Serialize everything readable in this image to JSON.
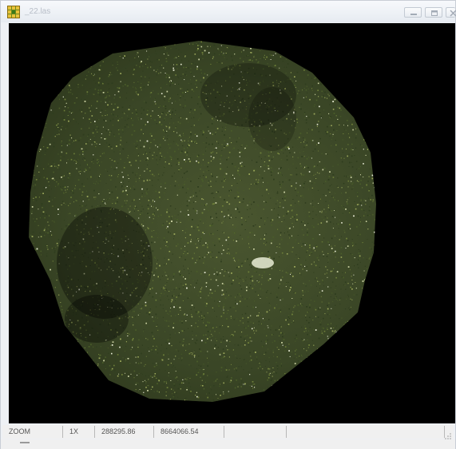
{
  "window": {
    "title": "_22.las",
    "icons": {
      "app": "grid-app-icon",
      "minimize": "minimize-icon",
      "maximize": "maximize-icon",
      "close": "close-icon"
    }
  },
  "viewport": {
    "content": "point-cloud-top-view",
    "background": "#000000",
    "palette": [
      "#2f3d1e",
      "#4a5c2a",
      "#6e7f3a",
      "#9aa65a",
      "#c9cfa0",
      "#e9ecd6"
    ]
  },
  "statusbar": {
    "mode": "ZOOM",
    "zoom_level": "1X",
    "x_coordinate": "288295.86",
    "y_coordinate": "8664066.54"
  }
}
